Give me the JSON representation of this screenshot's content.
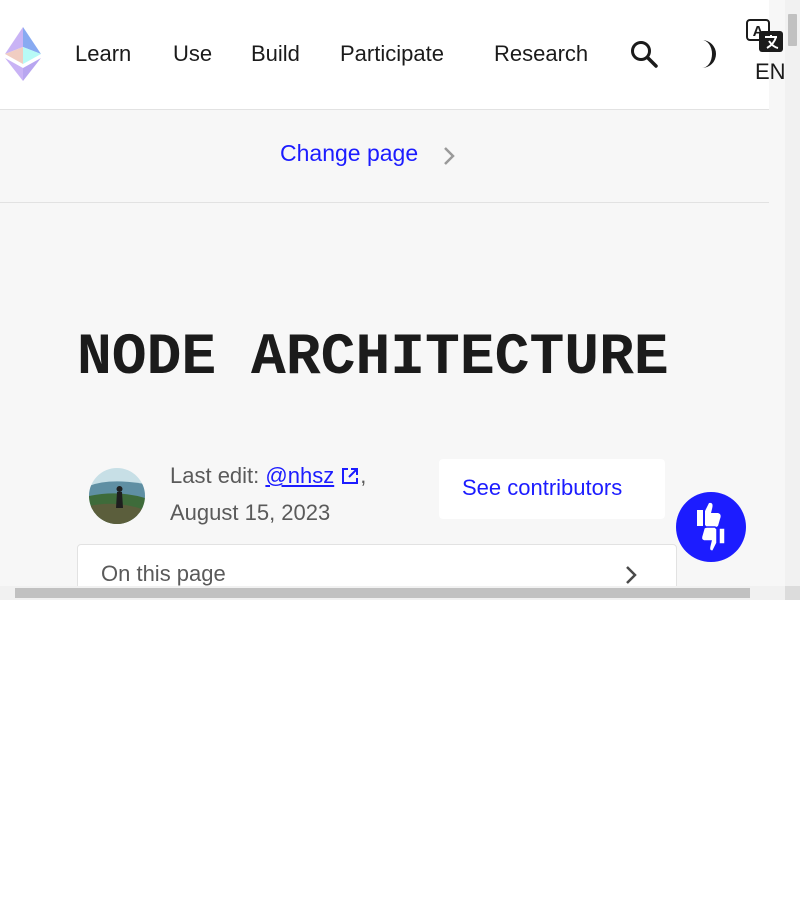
{
  "header": {
    "logo_name": "ethereum-logo",
    "nav": [
      {
        "label": "Learn"
      },
      {
        "label": "Use"
      },
      {
        "label": "Build"
      },
      {
        "label": "Participate"
      },
      {
        "label": "Research"
      }
    ],
    "language": "EN"
  },
  "change_page": {
    "label": "Change page"
  },
  "page": {
    "title": "NODE ARCHITECTURE",
    "last_edit_prefix": "Last edit: ",
    "author": "@nhsz",
    "comma": ",",
    "date": "August 15, 2023",
    "contributors_label": "See contributors"
  },
  "toc": {
    "label": "On this page"
  },
  "colors": {
    "accent": "#1c1cff",
    "text": "#1b1b1b",
    "muted": "#5a5a5a",
    "background": "#f7f7f7"
  },
  "icons": [
    "search-icon",
    "dark-mode-icon",
    "translate-icon",
    "chevron-right-icon",
    "external-link-icon",
    "feedback-thumbs-icon"
  ]
}
